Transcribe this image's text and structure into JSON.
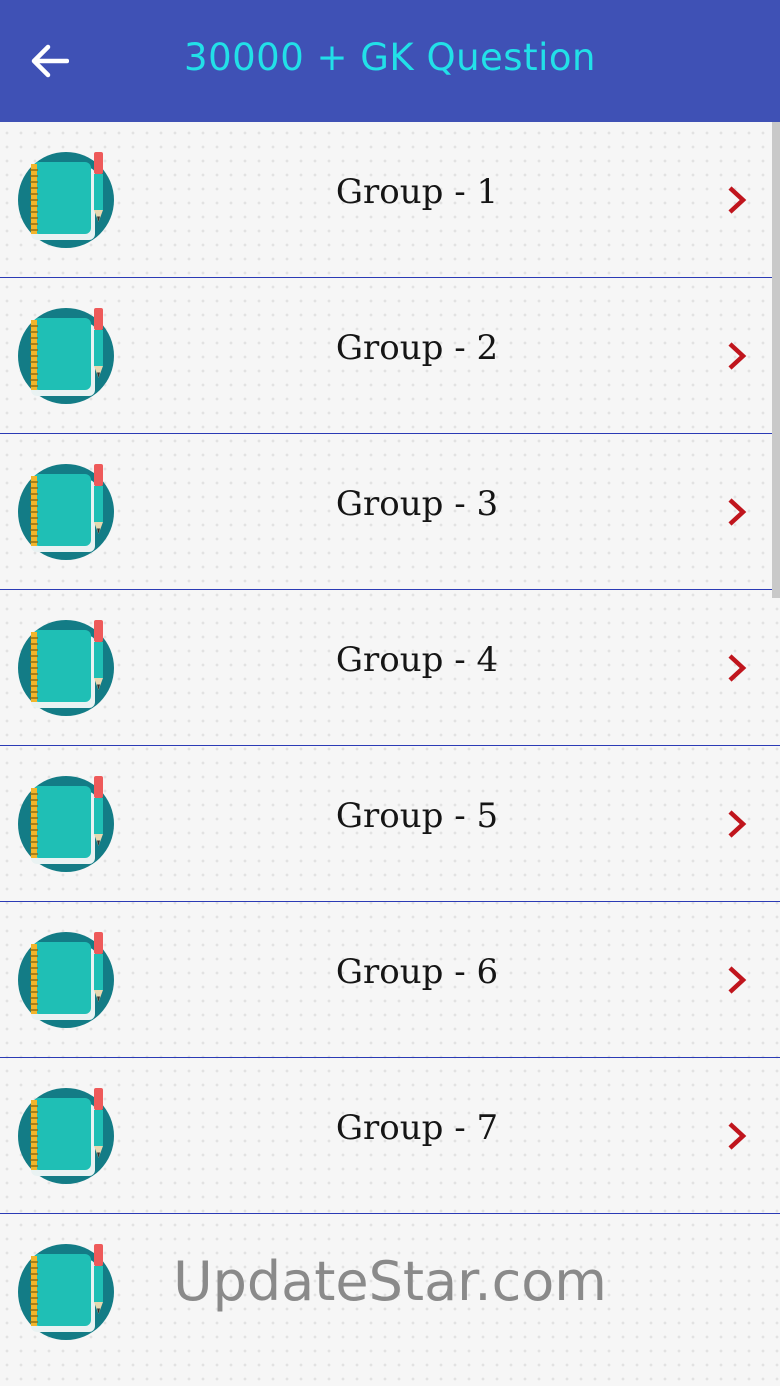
{
  "app_bar": {
    "title": "30000 + GK Question",
    "back_icon": "arrow-left-icon",
    "color": "#3f51b5",
    "title_color": "#22e0e8"
  },
  "groups": [
    {
      "label": "Group - 1"
    },
    {
      "label": "Group - 2"
    },
    {
      "label": "Group - 3"
    },
    {
      "label": "Group - 4"
    },
    {
      "label": "Group - 5"
    },
    {
      "label": "Group - 6"
    },
    {
      "label": "Group - 7"
    },
    {
      "label": ""
    }
  ],
  "item_icon": "notebook-pencil-icon",
  "item_chevron": "chevron-right-icon",
  "chevron_color": "#c0151d",
  "divider_color": "#2b3bb5",
  "watermark": "UpdateStar.com"
}
